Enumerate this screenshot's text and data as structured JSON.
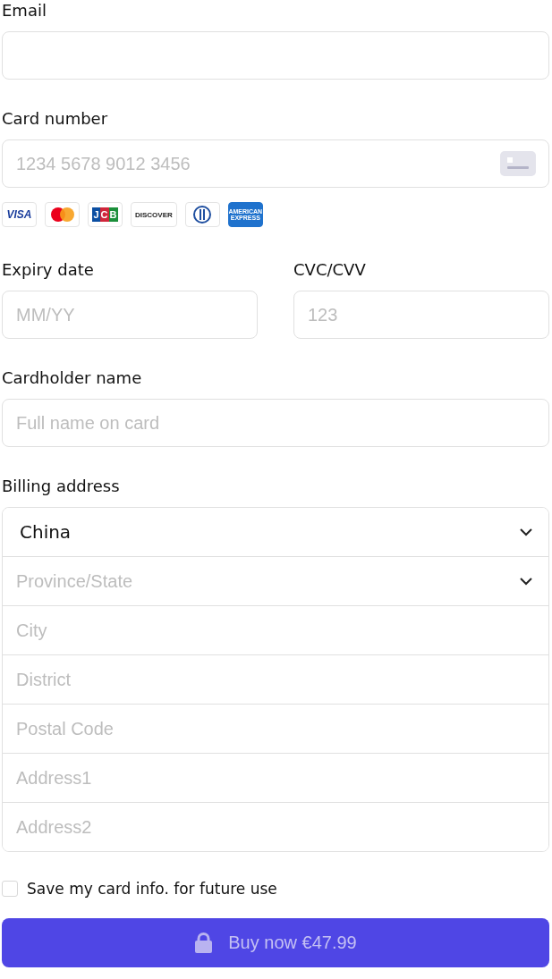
{
  "email": {
    "label": "Email"
  },
  "card_number": {
    "label": "Card number",
    "placeholder": "1234 5678 9012 3456"
  },
  "card_brands": [
    {
      "kind": "visa",
      "label": "VISA"
    },
    {
      "kind": "mastercard"
    },
    {
      "kind": "jcb",
      "label": "JCB"
    },
    {
      "kind": "discover",
      "label": "DISCOVER"
    },
    {
      "kind": "diners"
    },
    {
      "kind": "amex",
      "label": "AMERICAN EXPRESS"
    }
  ],
  "expiry": {
    "label": "Expiry date",
    "placeholder": "MM/YY"
  },
  "cvc": {
    "label": "CVC/CVV",
    "placeholder": "123"
  },
  "cardholder": {
    "label": "Cardholder name",
    "placeholder": "Full name on card"
  },
  "billing": {
    "label": "Billing address",
    "fields": [
      {
        "kind": "select",
        "value": "China"
      },
      {
        "kind": "select",
        "placeholder": "Province/State"
      },
      {
        "kind": "input",
        "placeholder": "City"
      },
      {
        "kind": "input",
        "placeholder": "District"
      },
      {
        "kind": "input",
        "placeholder": "Postal Code"
      },
      {
        "kind": "input",
        "placeholder": "Address1"
      },
      {
        "kind": "input",
        "placeholder": "Address2"
      }
    ]
  },
  "save_card": {
    "label": "Save my card info. for future use",
    "checked": false
  },
  "buy_button": {
    "label": "Buy now €47.99"
  }
}
